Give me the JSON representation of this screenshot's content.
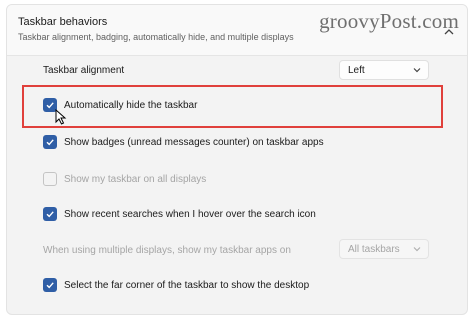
{
  "header": {
    "title": "Taskbar behaviors",
    "subtitle": "Taskbar alignment, badging, automatically hide, and multiple displays",
    "collapse_icon": "chevron-up-icon"
  },
  "watermark": "groovyPost.com",
  "alignment": {
    "label": "Taskbar alignment",
    "value": "Left"
  },
  "settings": [
    {
      "label": "Automatically hide the taskbar",
      "checked": true,
      "enabled": true
    },
    {
      "label": "Show badges (unread messages counter) on taskbar apps",
      "checked": true,
      "enabled": true
    },
    {
      "label": "Show my taskbar on all displays",
      "checked": false,
      "enabled": false
    },
    {
      "label": "Show recent searches when I hover over the search icon",
      "checked": true,
      "enabled": true
    },
    {
      "label": "Select the far corner of the taskbar to show the desktop",
      "checked": true,
      "enabled": true
    }
  ],
  "multi_display": {
    "label": "When using multiple displays, show my taskbar apps on",
    "value": "All taskbars"
  },
  "colors": {
    "accent": "#2f5ea6",
    "highlight": "#e0403b"
  }
}
